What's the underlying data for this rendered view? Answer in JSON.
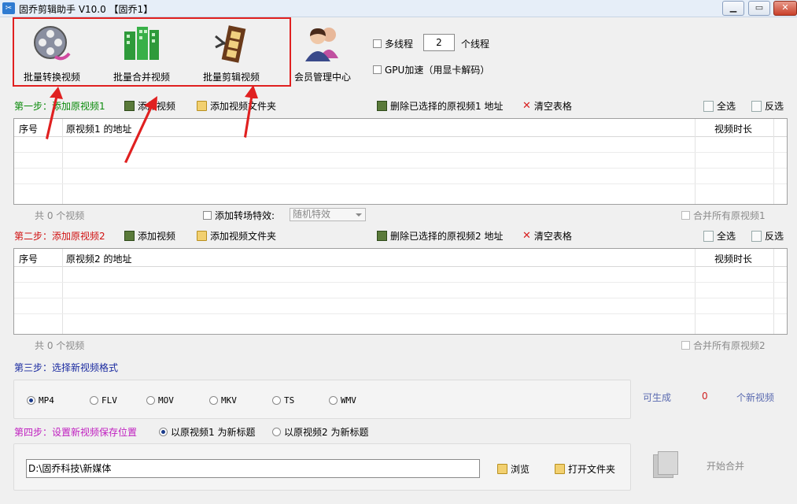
{
  "window": {
    "title": "固乔剪辑助手 V10.0 【固乔1】",
    "app_icon": "scissors-icon"
  },
  "toolbar": {
    "items": [
      {
        "label": "批量转换视频",
        "icon": "film-reel-convert-icon"
      },
      {
        "label": "批量合并视频",
        "icon": "merge-blocks-icon"
      },
      {
        "label": "批量剪辑视频",
        "icon": "film-strip-cut-icon"
      },
      {
        "label": "会员管理中心",
        "icon": "members-icon"
      }
    ],
    "multithread_label": "多线程",
    "thread_count": "2",
    "thread_unit": "个线程",
    "gpu_label": "GPU加速（用显卡解码）"
  },
  "step1": {
    "title": "第一步：添加原视频1",
    "add_video": "添加视频",
    "add_folder": "添加视频文件夹",
    "delete_selected": "删除已选择的原视频1 地址",
    "clear_table": "清空表格",
    "select_all": "全选",
    "invert": "反选",
    "columns": [
      "序号",
      "原视频1 的地址",
      "视频时长"
    ],
    "count_text": "共 0 个视频",
    "transition_label": "添加转场特效:",
    "transition_value": "随机特效",
    "merge_all": "合并所有原视频1"
  },
  "step2": {
    "title": "第二步：添加原视频2",
    "add_video": "添加视频",
    "add_folder": "添加视频文件夹",
    "delete_selected": "删除已选择的原视频2 地址",
    "clear_table": "清空表格",
    "select_all": "全选",
    "invert": "反选",
    "columns": [
      "序号",
      "原视频2 的地址",
      "视频时长"
    ],
    "count_text": "共 0 个视频",
    "merge_all": "合并所有原视频2"
  },
  "step3": {
    "title": "第三步：选择新视频格式",
    "formats": [
      "MP4",
      "FLV",
      "MOV",
      "MKV",
      "TS",
      "WMV"
    ],
    "selected": "MP4",
    "can_generate": "可生成",
    "count": "0",
    "new_videos": "个新视频"
  },
  "step4": {
    "title": "第四步：设置新视频保存位置",
    "option1": "以原视频1 为新标题",
    "option2": "以原视频2 为新标题",
    "selected": "option1",
    "path": "D:\\固乔科技\\新媒体",
    "browse": "浏览",
    "open_folder": "打开文件夹",
    "start": "开始合并"
  },
  "colors": {
    "annotation_red": "#e02020",
    "step1": "#0a8a0a",
    "step2": "#d01010",
    "step3": "#1a2aa0",
    "step4": "#c020c0"
  }
}
